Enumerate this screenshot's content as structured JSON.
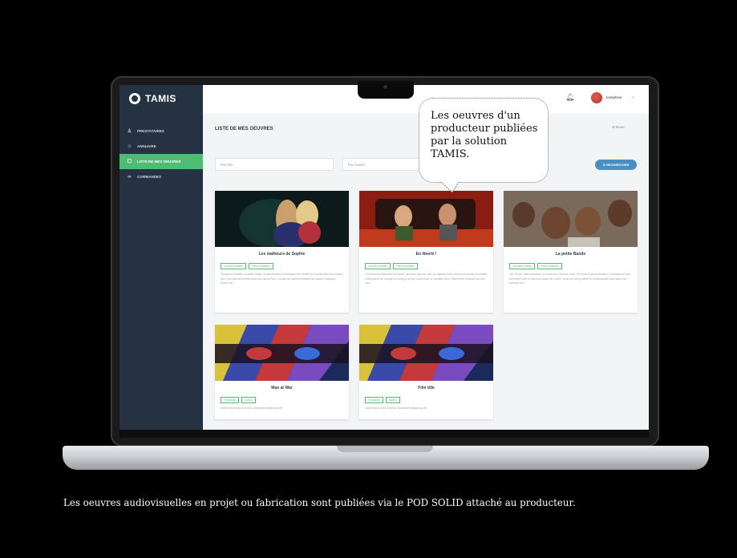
{
  "app": {
    "name": "TAMIS"
  },
  "sidebar": {
    "items": [
      {
        "label": "PRESTATAIRES",
        "icon": "person-icon"
      },
      {
        "label": "ANNUAIRE",
        "icon": "people-icon"
      },
      {
        "label": "LISTE DE MES OEUVRES",
        "icon": "list-icon",
        "active": true
      },
      {
        "label": "COMMANDES",
        "icon": "link-icon"
      }
    ]
  },
  "topbar": {
    "username": "Josephine"
  },
  "main": {
    "title": "LISTE DE MES OEUVRES",
    "new_label": "Nouv.",
    "search": {
      "title_placeholder": "Par titre",
      "author_placeholder": "Par Auteur",
      "button": "RECHERCHER"
    },
    "cards": [
      {
        "title": "Les malheurs de Sophie",
        "tags": [
          "Les films Pelléas",
          "Pierre-Sylvester"
        ],
        "description": "Depuis son château, la petite Sophie ne peut résister à la tentation de l'interdit et ce qu'elle aime par-dessus tout, c'est faire des bêtises avec son cousin Paul. Lorsque ses parents décident de repartir l'Amérique, Sophie est..."
      },
      {
        "title": "En liberté !",
        "tags": [
          "Les films Pelléas",
          "Pierre-Sylvester"
        ],
        "description": "Yvonne jeune inspectrice de police, découvre que son mari, le capitaine Santi, héros local tombé au combat, n'était pas le flic courageux et intègre qu'elle croyait mais un véritable ripou. Déterminée à réparer les torts com..."
      },
      {
        "title": "La petite Bande",
        "tags": [
          "Les films Pelléas",
          "Pierre-Sylvester"
        ],
        "description": "Cat, Fouad, Sami et Antoine ont douze ans. Aimé en a dix. Par fierté et par provocation, ils décident un jour de mettre le feu à l'usine qui pollue leur rivière. Aussi leur fait qu'affolés ils s'embarquent alors dans une aventure dét..."
      },
      {
        "title": "Man at War",
        "tags": [
          "Production",
          "Auteur"
        ],
        "description": "Lorem ipsum dolor sit amet, consectetur adipiscing elit."
      },
      {
        "title": "Film title",
        "tags": [
          "Production",
          "Auteur"
        ],
        "description": "Lorem ipsum dolor sit amet, consectetur adipiscing elit."
      }
    ]
  },
  "bubble": {
    "text": "Les oeuvres d'un producteur publiées par la solution TAMIS."
  },
  "caption": "Les oeuvres audiovisuelles en projet ou fabrication sont publiées via le POD SOLID attaché au producteur.",
  "colors": {
    "sidebar": "#243241",
    "accent": "#4dbd74",
    "button": "#4a8fc1"
  }
}
